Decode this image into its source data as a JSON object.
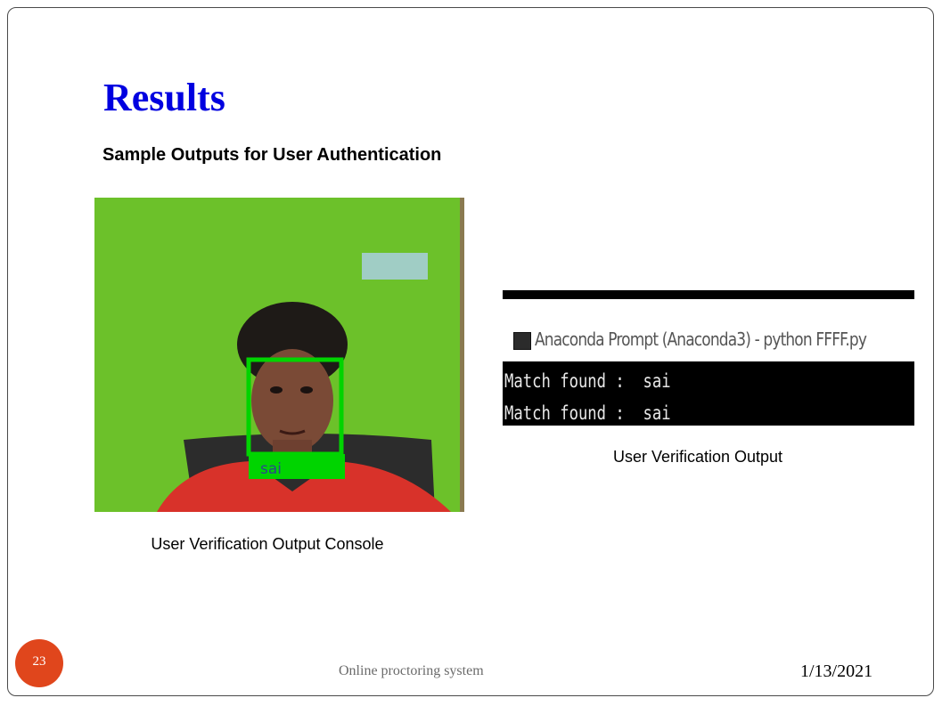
{
  "slide": {
    "title": "Results",
    "subtitle": "Sample Outputs for User Authentication",
    "number": "23",
    "footer": "Online proctoring system",
    "date": "1/13/2021"
  },
  "figure_left": {
    "face_label": "sai",
    "caption": "User Verification Output Console",
    "colors": {
      "background": "#6cc12a",
      "box": "#00d400"
    }
  },
  "figure_right": {
    "console_title": "Anaconda Prompt (Anaconda3) - python  FFFF.py",
    "lines": [
      "Match found :  sai",
      "Match found :  sai"
    ],
    "caption": "User Verification Output"
  },
  "colors": {
    "title": "#0000e0",
    "badge": "#e0461c"
  }
}
